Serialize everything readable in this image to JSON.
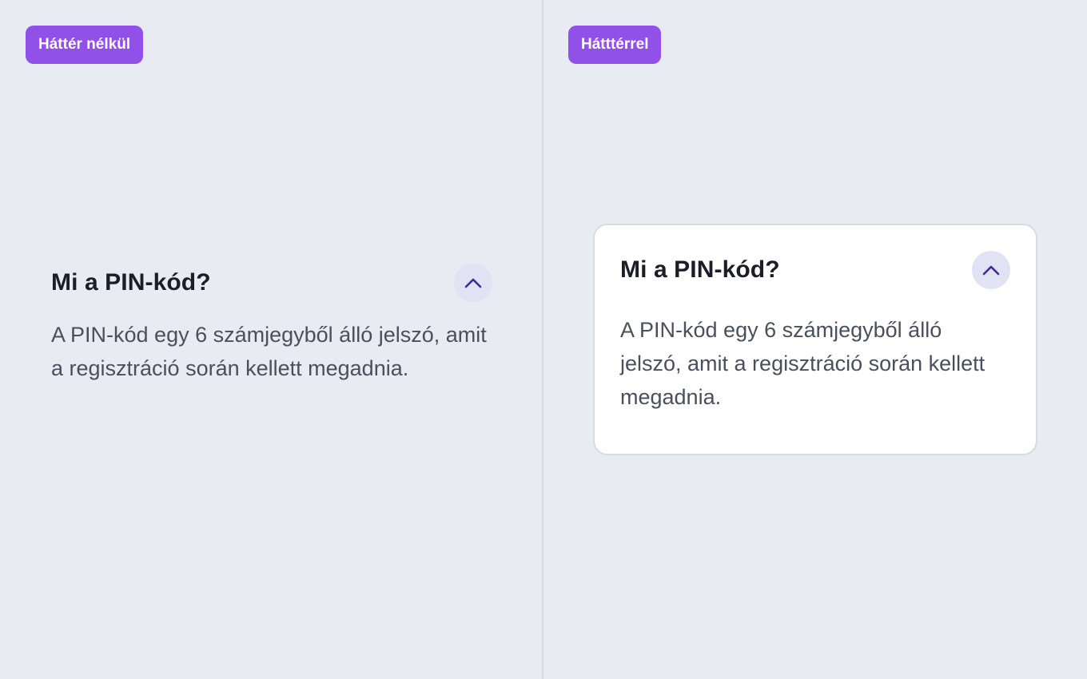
{
  "left_panel": {
    "badge": "Háttér nélkül",
    "faq": {
      "question": "Mi a PIN-kód?",
      "answer": "A PIN-kód egy 6 számjegyből álló jelszó, amit a regisztráció során kellett megadnia.",
      "toggle_icon": "chevron-up-icon",
      "expanded": true
    }
  },
  "right_panel": {
    "badge": "Hátttérrel",
    "faq": {
      "question": "Mi a PIN-kód?",
      "answer": "A PIN-kód egy 6 számjegyből álló jelszó, amit a regisztráció során kellett megadnia.",
      "toggle_icon": "chevron-up-icon",
      "expanded": true
    }
  },
  "colors": {
    "background": "#e8ebf1",
    "badge": "#9150e8",
    "card": "#ffffff",
    "toggle_bg": "#e1e2f3",
    "chevron": "#3b2a9c"
  }
}
